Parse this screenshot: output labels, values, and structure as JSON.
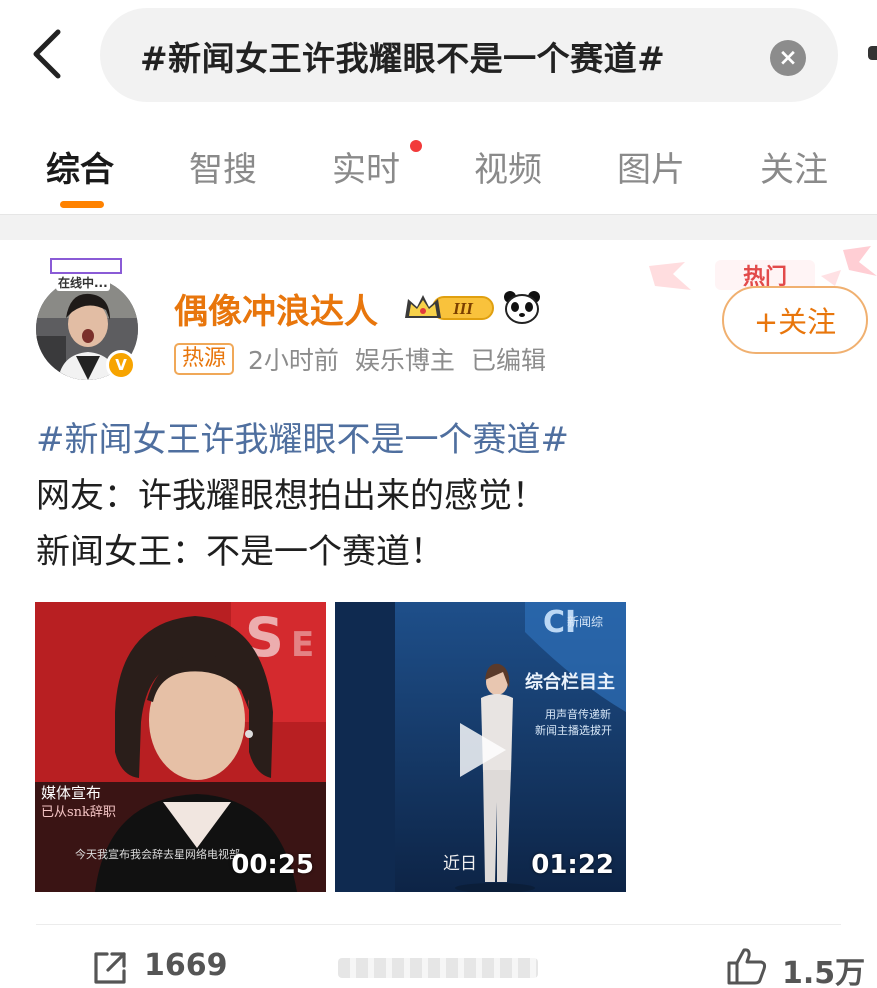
{
  "search": {
    "query": "#新闻女王许我耀眼不是一个赛道#",
    "clear_glyph": "×"
  },
  "tabs": [
    {
      "label": "综合",
      "active": true
    },
    {
      "label": "智搜",
      "active": false
    },
    {
      "label": "实时",
      "active": false,
      "has_red_dot": true
    },
    {
      "label": "视频",
      "active": false
    },
    {
      "label": "图片",
      "active": false
    },
    {
      "label": "关注",
      "active": false
    }
  ],
  "post": {
    "avatar_live_label": "在线中...",
    "author": "偶像冲浪达人",
    "crown_level": "III",
    "hot_ribbon_text": "热门",
    "follow_label": "+关注",
    "source_tag": "热源",
    "time": "2小时前",
    "role": "娱乐博主",
    "edited": "已编辑",
    "lines": [
      "#新闻女王许我耀眼不是一个赛道#",
      "网友：许我耀眼想拍出来的感觉！",
      "新闻女王：不是一个赛道！"
    ],
    "media": [
      {
        "type": "video",
        "duration": "00:25",
        "overlay_caption": "今天我宣布我会辞去星网络电视部"
      },
      {
        "type": "video",
        "duration": "01:22",
        "recent_label": "近日",
        "overlay_caption": "综合栏目主"
      }
    ]
  },
  "actions": {
    "share_count": "1669",
    "like_count": "1.5万"
  },
  "colors": {
    "accent_orange": "#ff8200",
    "author_orange": "#e8760c",
    "hashtag_blue": "#4f6f9f",
    "red_dot": "#f23a3a"
  },
  "icons": [
    "back-arrow-icon",
    "clear-icon",
    "crown-badge-icon",
    "panda-icon",
    "verified-icon",
    "play-icon",
    "share-icon",
    "like-icon"
  ]
}
